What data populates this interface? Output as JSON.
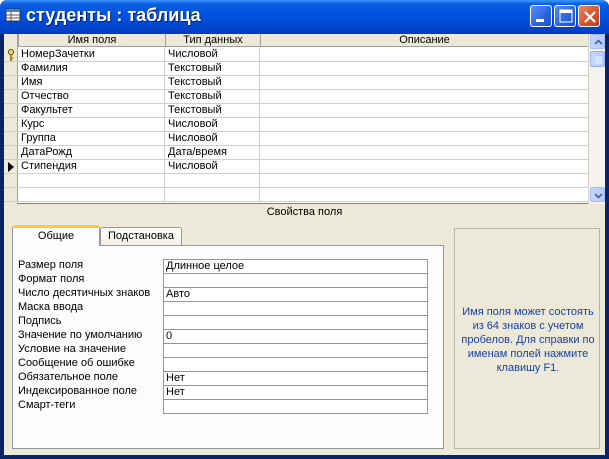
{
  "window": {
    "title": "студенты : таблица"
  },
  "grid": {
    "headers": {
      "name": "Имя поля",
      "type": "Тип данных",
      "description": "Описание"
    },
    "rows": [
      {
        "name": "НомерЗачетки",
        "type": "Числовой",
        "description": "",
        "key": true,
        "current": false
      },
      {
        "name": "Фамилия",
        "type": "Текстовый",
        "description": "",
        "key": false,
        "current": false
      },
      {
        "name": "Имя",
        "type": "Текстовый",
        "description": "",
        "key": false,
        "current": false
      },
      {
        "name": "Отчество",
        "type": "Текстовый",
        "description": "",
        "key": false,
        "current": false
      },
      {
        "name": "Факультет",
        "type": "Текстовый",
        "description": "",
        "key": false,
        "current": false
      },
      {
        "name": "Курс",
        "type": "Числовой",
        "description": "",
        "key": false,
        "current": false
      },
      {
        "name": "Группа",
        "type": "Числовой",
        "description": "",
        "key": false,
        "current": false
      },
      {
        "name": "ДатаРожд",
        "type": "Дата/время",
        "description": "",
        "key": false,
        "current": false
      },
      {
        "name": "Стипендия",
        "type": "Числовой",
        "description": "",
        "key": false,
        "current": true
      },
      {
        "name": "",
        "type": "",
        "description": "",
        "key": false,
        "current": false
      },
      {
        "name": "",
        "type": "",
        "description": "",
        "key": false,
        "current": false
      }
    ]
  },
  "properties": {
    "section_label": "Свойства поля",
    "tabs": [
      {
        "label": "Общие",
        "active": true
      },
      {
        "label": "Подстановка",
        "active": false
      }
    ],
    "rows": [
      {
        "label": "Размер поля",
        "value": "Длинное целое"
      },
      {
        "label": "Формат поля",
        "value": ""
      },
      {
        "label": "Число десятичных знаков",
        "value": "Авто"
      },
      {
        "label": "Маска ввода",
        "value": ""
      },
      {
        "label": "Подпись",
        "value": ""
      },
      {
        "label": "Значение по умолчанию",
        "value": "0"
      },
      {
        "label": "Условие на значение",
        "value": ""
      },
      {
        "label": "Сообщение об ошибке",
        "value": ""
      },
      {
        "label": "Обязательное поле",
        "value": "Нет"
      },
      {
        "label": "Индексированное поле",
        "value": "Нет"
      },
      {
        "label": "Смарт-теги",
        "value": ""
      }
    ],
    "hint": "Имя поля может состоять из 64 знаков с учетом пробелов.  Для справки по именам полей нажмите клавишу F1."
  },
  "colors": {
    "titlebar": "#0054e3",
    "hint_text": "#1a3fa0",
    "tab_highlight": "#ffc83c"
  }
}
